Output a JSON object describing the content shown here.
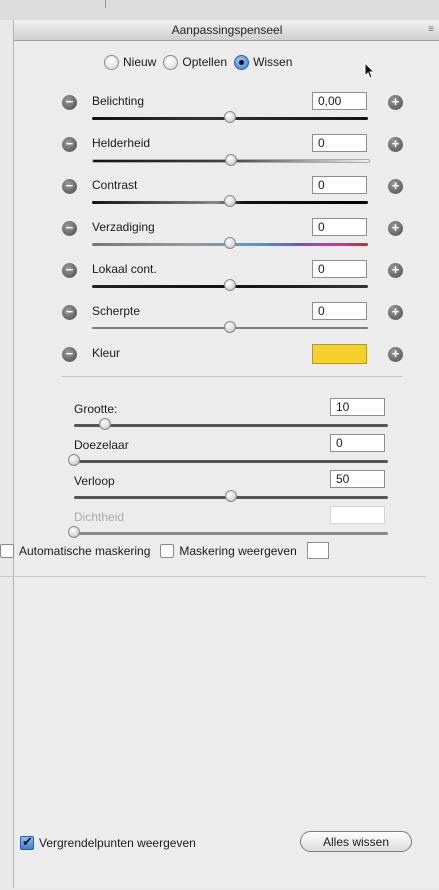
{
  "panel": {
    "title": "Aanpassingspenseel"
  },
  "mode": {
    "options": [
      "Nieuw",
      "Optellen",
      "Wissen"
    ],
    "selected": "Wissen"
  },
  "adjustments": [
    {
      "label": "Belichting",
      "value": "0,00",
      "slider": 0.5
    },
    {
      "label": "Helderheid",
      "value": "0",
      "slider": 0.5
    },
    {
      "label": "Contrast",
      "value": "0",
      "slider": 0.5
    },
    {
      "label": "Verzadiging",
      "value": "0",
      "slider": 0.5
    },
    {
      "label": "Lokaal cont.",
      "value": "0",
      "slider": 0.5
    },
    {
      "label": "Scherpte",
      "value": "0",
      "slider": 0.5
    },
    {
      "label": "Kleur",
      "color": "#f5cf2b"
    }
  ],
  "brush": [
    {
      "label": "Grootte:",
      "value": "10",
      "slider": 0.1
    },
    {
      "label": "Doezelaar",
      "value": "0",
      "slider": 0.0
    },
    {
      "label": "Verloop",
      "value": "50",
      "slider": 0.5
    },
    {
      "label": "Dichtheid",
      "value": "",
      "slider": 0.0,
      "disabled": true
    }
  ],
  "options": {
    "auto_mask": "Automatische maskering",
    "show_mask": "Maskering weergeven",
    "show_pins": "Vergrendelpunten weergeven",
    "show_pins_checked": true
  },
  "buttons": {
    "clear_all": "Alles wissen"
  },
  "colors": {
    "accent": "#3b7fd0",
    "swatch": "#f5cf2b"
  }
}
